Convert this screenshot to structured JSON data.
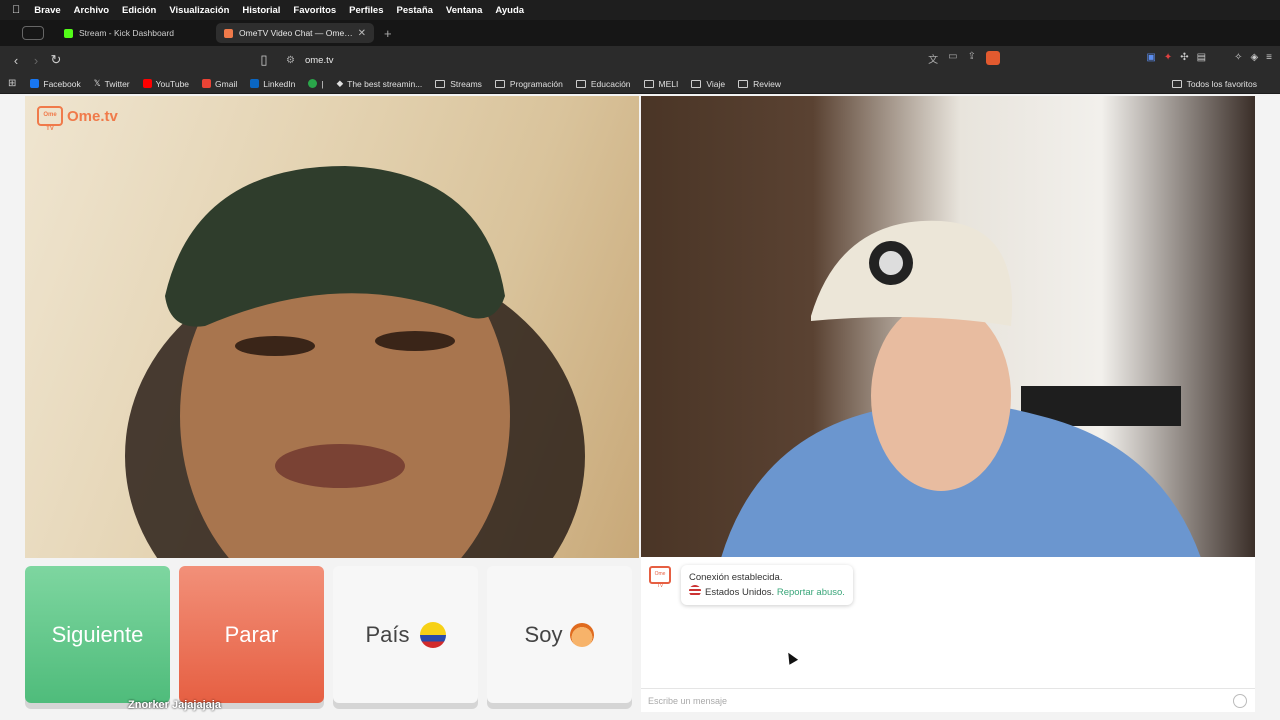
{
  "menubar": {
    "app": "Brave",
    "items": [
      "Archivo",
      "Edición",
      "Visualización",
      "Historial",
      "Favoritos",
      "Perfiles",
      "Pestaña",
      "Ventana",
      "Ayuda"
    ]
  },
  "tabs": [
    {
      "title": "Stream - Kick Dashboard",
      "favicon_color": "#53fc18"
    },
    {
      "title": "OmeTV Video Chat — Omegle",
      "favicon_color": "#f07a4a"
    }
  ],
  "address": {
    "url": "ome.tv"
  },
  "bookmarks": {
    "items": [
      {
        "label": "Facebook",
        "color": "#1877f2"
      },
      {
        "label": "Twitter",
        "color": "#ffffff"
      },
      {
        "label": "YouTube",
        "color": "#ff0000"
      },
      {
        "label": "Gmail",
        "color": "#ea4335"
      },
      {
        "label": "LinkedIn",
        "color": "#0a66c2"
      },
      {
        "label": "|",
        "color": "#2aa64a"
      },
      {
        "label": "The best streamin...",
        "color": "#dddddd"
      }
    ],
    "folders": [
      "Streams",
      "Programación",
      "Educación",
      "MELI",
      "Viaje",
      "Review"
    ],
    "all_favorites": "Todos los favoritos"
  },
  "site": {
    "logo_text": "Ome.tv",
    "logo_badge": "Ome TV",
    "buttons": {
      "next": "Siguiente",
      "stop": "Parar",
      "country": "País",
      "gender": "Soy"
    },
    "overlay_names": "Znorker Jajajajaja",
    "chat": {
      "status": "Conexión establecida.",
      "country": "Estados Unidos.",
      "report": "Reportar abuso.",
      "placeholder": "Escribe un mensaje"
    }
  }
}
